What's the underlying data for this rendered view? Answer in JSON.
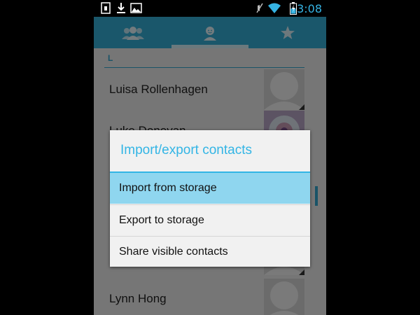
{
  "status_bar": {
    "time": "3:08",
    "icons": [
      "sim-icon",
      "download-icon",
      "image-icon",
      "mute-icon",
      "wifi-icon",
      "battery-icon"
    ]
  },
  "tabs": [
    {
      "icon": "groups-icon",
      "selected": false
    },
    {
      "icon": "person-icon",
      "selected": true
    },
    {
      "icon": "star-icon",
      "selected": false
    }
  ],
  "contacts": {
    "section_letter": "L",
    "items": [
      {
        "name": "Luisa Rollenhagen"
      },
      {
        "name": "Luke Donovan"
      },
      {
        "name": "Lynn Hong"
      }
    ]
  },
  "dialog": {
    "title": "Import/export contacts",
    "options": [
      {
        "label": "Import from storage",
        "highlighted": true
      },
      {
        "label": "Export to storage",
        "highlighted": false
      },
      {
        "label": "Share visible contacts",
        "highlighted": false
      }
    ]
  },
  "colors": {
    "accent": "#33b5e5",
    "tab_bar": "#34aed7",
    "highlight": "#8fd6ef"
  }
}
